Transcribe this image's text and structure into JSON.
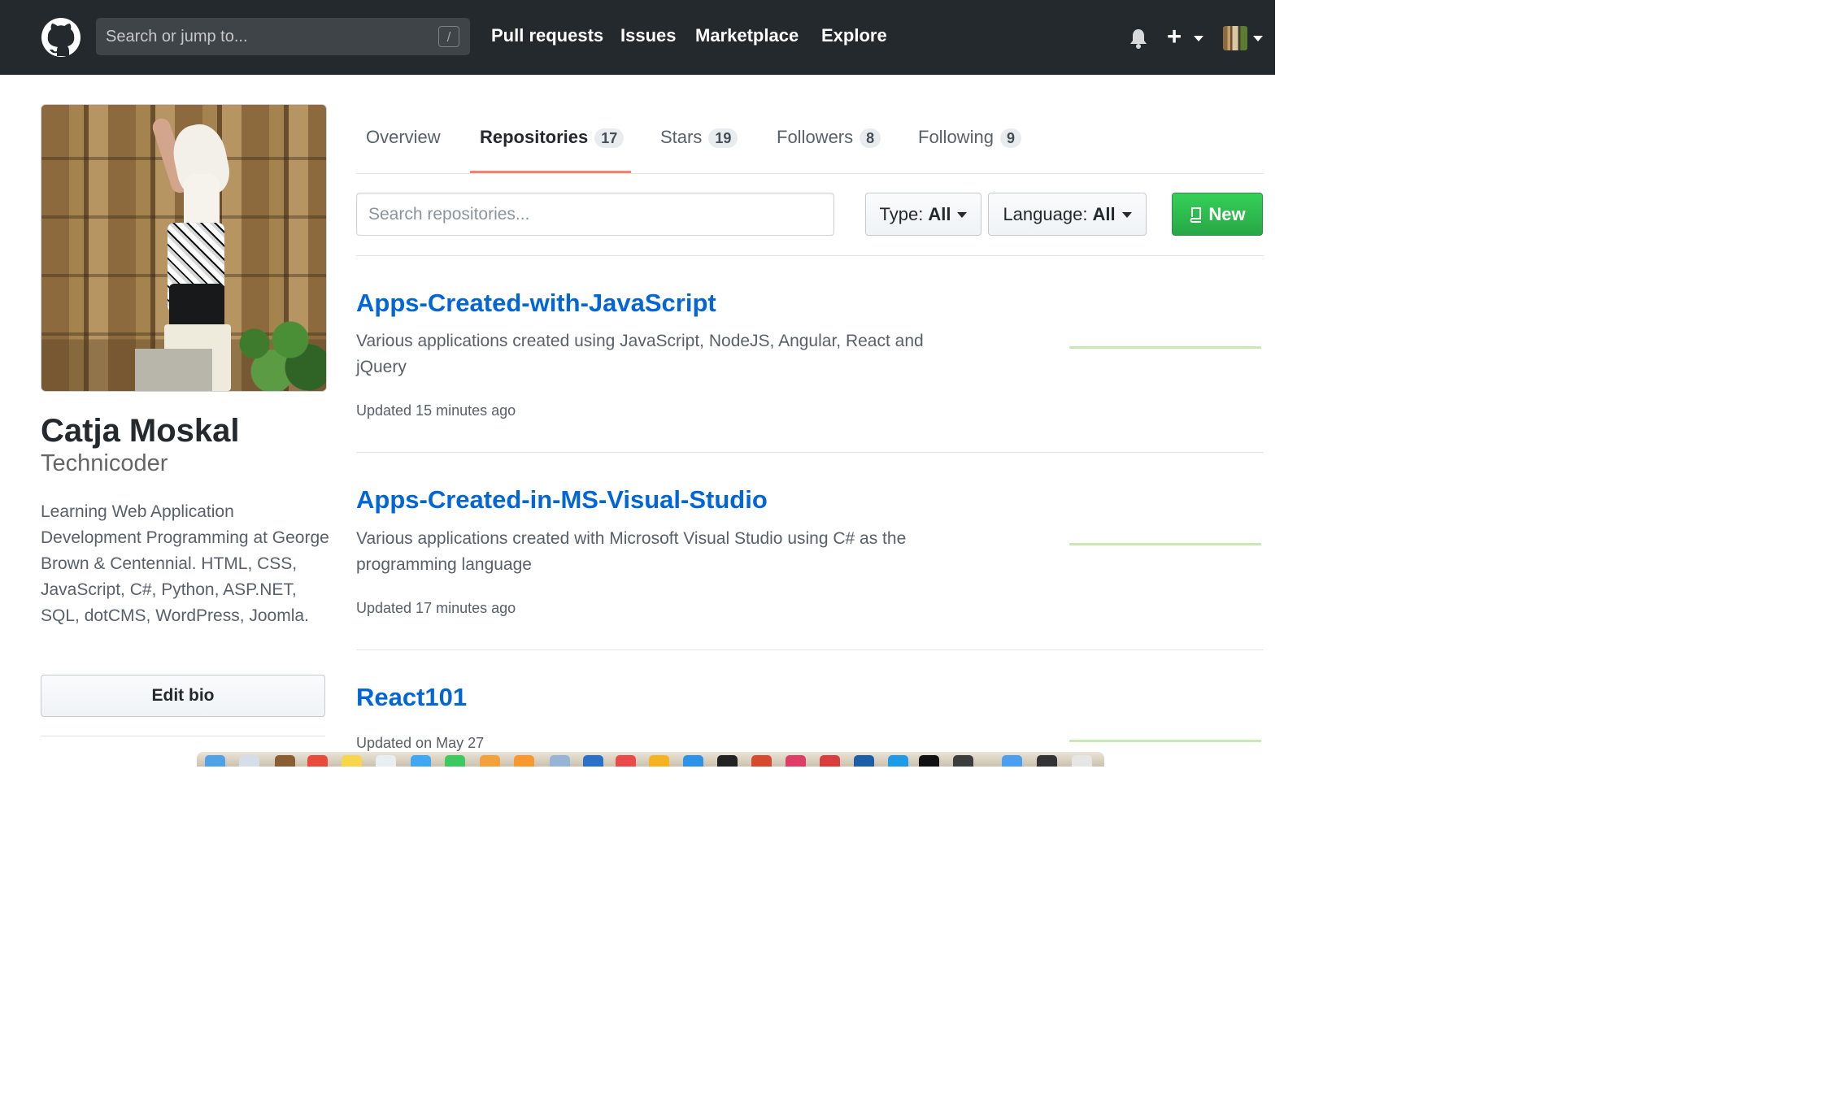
{
  "header": {
    "search_placeholder": "Search or jump to...",
    "search_shortcut": "/",
    "nav": {
      "pull_requests": "Pull requests",
      "issues": "Issues",
      "marketplace": "Marketplace",
      "explore": "Explore"
    },
    "create_label": "+"
  },
  "profile": {
    "name": "Catja Moskal",
    "username": "Technicoder",
    "bio": "Learning Web Application Development Programming at George Brown & Centennial. HTML, CSS, JavaScript, C#, Python, ASP.NET, SQL, dotCMS, WordPress, Joomla.",
    "edit_bio": "Edit bio"
  },
  "tabs": {
    "overview": {
      "label": "Overview"
    },
    "repositories": {
      "label": "Repositories",
      "count": "17"
    },
    "stars": {
      "label": "Stars",
      "count": "19"
    },
    "followers": {
      "label": "Followers",
      "count": "8"
    },
    "following": {
      "label": "Following",
      "count": "9"
    }
  },
  "filters": {
    "search_placeholder": "Search repositories...",
    "type_label": "Type:",
    "type_value": "All",
    "language_label": "Language:",
    "language_value": "All",
    "new_label": "New"
  },
  "repositories": [
    {
      "name": "Apps-Created-with-JavaScript",
      "description": "Various applications created using JavaScript, NodeJS, Angular, React and jQuery",
      "updated": "Updated 15 minutes ago"
    },
    {
      "name": "Apps-Created-in-MS-Visual-Studio",
      "description": "Various applications created with Microsoft Visual Studio using C# as the programming language",
      "updated": "Updated 17 minutes ago"
    },
    {
      "name": "React101",
      "description": "",
      "updated": "Updated on May 27"
    }
  ],
  "colors": {
    "header_bg": "#24292e",
    "link": "#0366d6",
    "new_button": "#28a745",
    "active_tab": "#f9826c"
  }
}
